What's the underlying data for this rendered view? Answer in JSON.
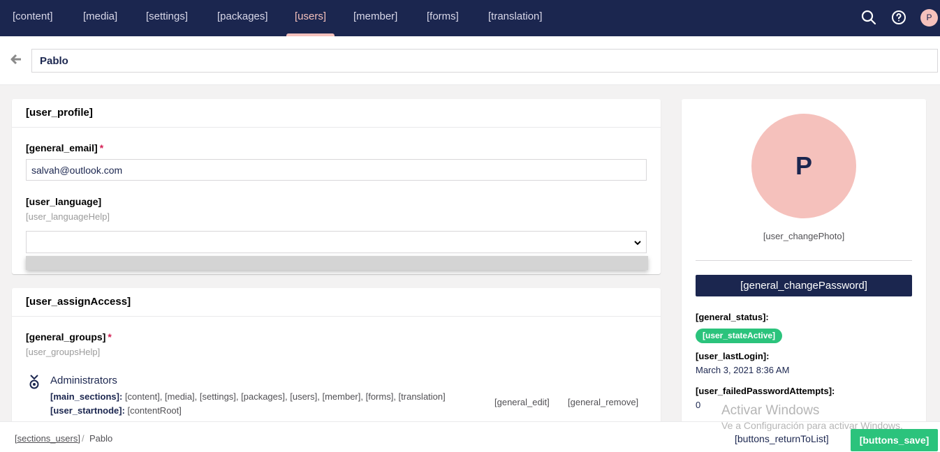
{
  "nav": {
    "items": [
      "[content]",
      "[media]",
      "[settings]",
      "[packages]",
      "[users]",
      "[member]",
      "[forms]",
      "[translation]"
    ],
    "active": "[users]",
    "avatar_initial": "P"
  },
  "header": {
    "name_value": "Pablo"
  },
  "profile": {
    "title": "[user_profile]",
    "email_label": "[general_email]",
    "email_value": "salvah@outlook.com",
    "language_label": "[user_language]",
    "language_help": "[user_languageHelp]",
    "required_mark": "*"
  },
  "access": {
    "title": "[user_assignAccess]",
    "groups_label": "[general_groups]",
    "groups_help": "[user_groupsHelp]",
    "required_mark": "*",
    "group": {
      "name": "Administrators",
      "sections_label": "[main_sections]:",
      "sections_value": "[content], [media], [settings], [packages], [users], [member], [forms], [translation]",
      "startnode_label": "[user_startnode]:",
      "startnode_value": "[contentRoot]",
      "edit_label": "[general_edit]",
      "remove_label": "[general_remove]"
    }
  },
  "side": {
    "avatar_initial": "P",
    "change_photo": "[user_changePhoto]",
    "change_password": "[general_changePassword]",
    "status_label": "[general_status]:",
    "status_badge": "[user_stateActive]",
    "last_login_label": "[user_lastLogin]:",
    "last_login_value": "March 3, 2021 8:36 AM",
    "failed_label": "[user_failedPasswordAttempts]:",
    "failed_value": "0"
  },
  "footer": {
    "crumb_root": "[sections_users]",
    "crumb_sep": "/",
    "crumb_current": "Pablo",
    "return_label": "[buttons_returnToList]",
    "save_label": "[buttons_save]"
  },
  "watermark": {
    "title": "Activar Windows",
    "subtitle": "Ve a Configuración para activar Windows."
  },
  "colors": {
    "navy": "#1b264f",
    "pink": "#f5c1bc",
    "green": "#2bc37c",
    "required": "#d42054"
  },
  "icons": [
    "search-icon",
    "help-icon",
    "back-arrow-icon",
    "chevron-down-icon",
    "group-medal-icon"
  ]
}
